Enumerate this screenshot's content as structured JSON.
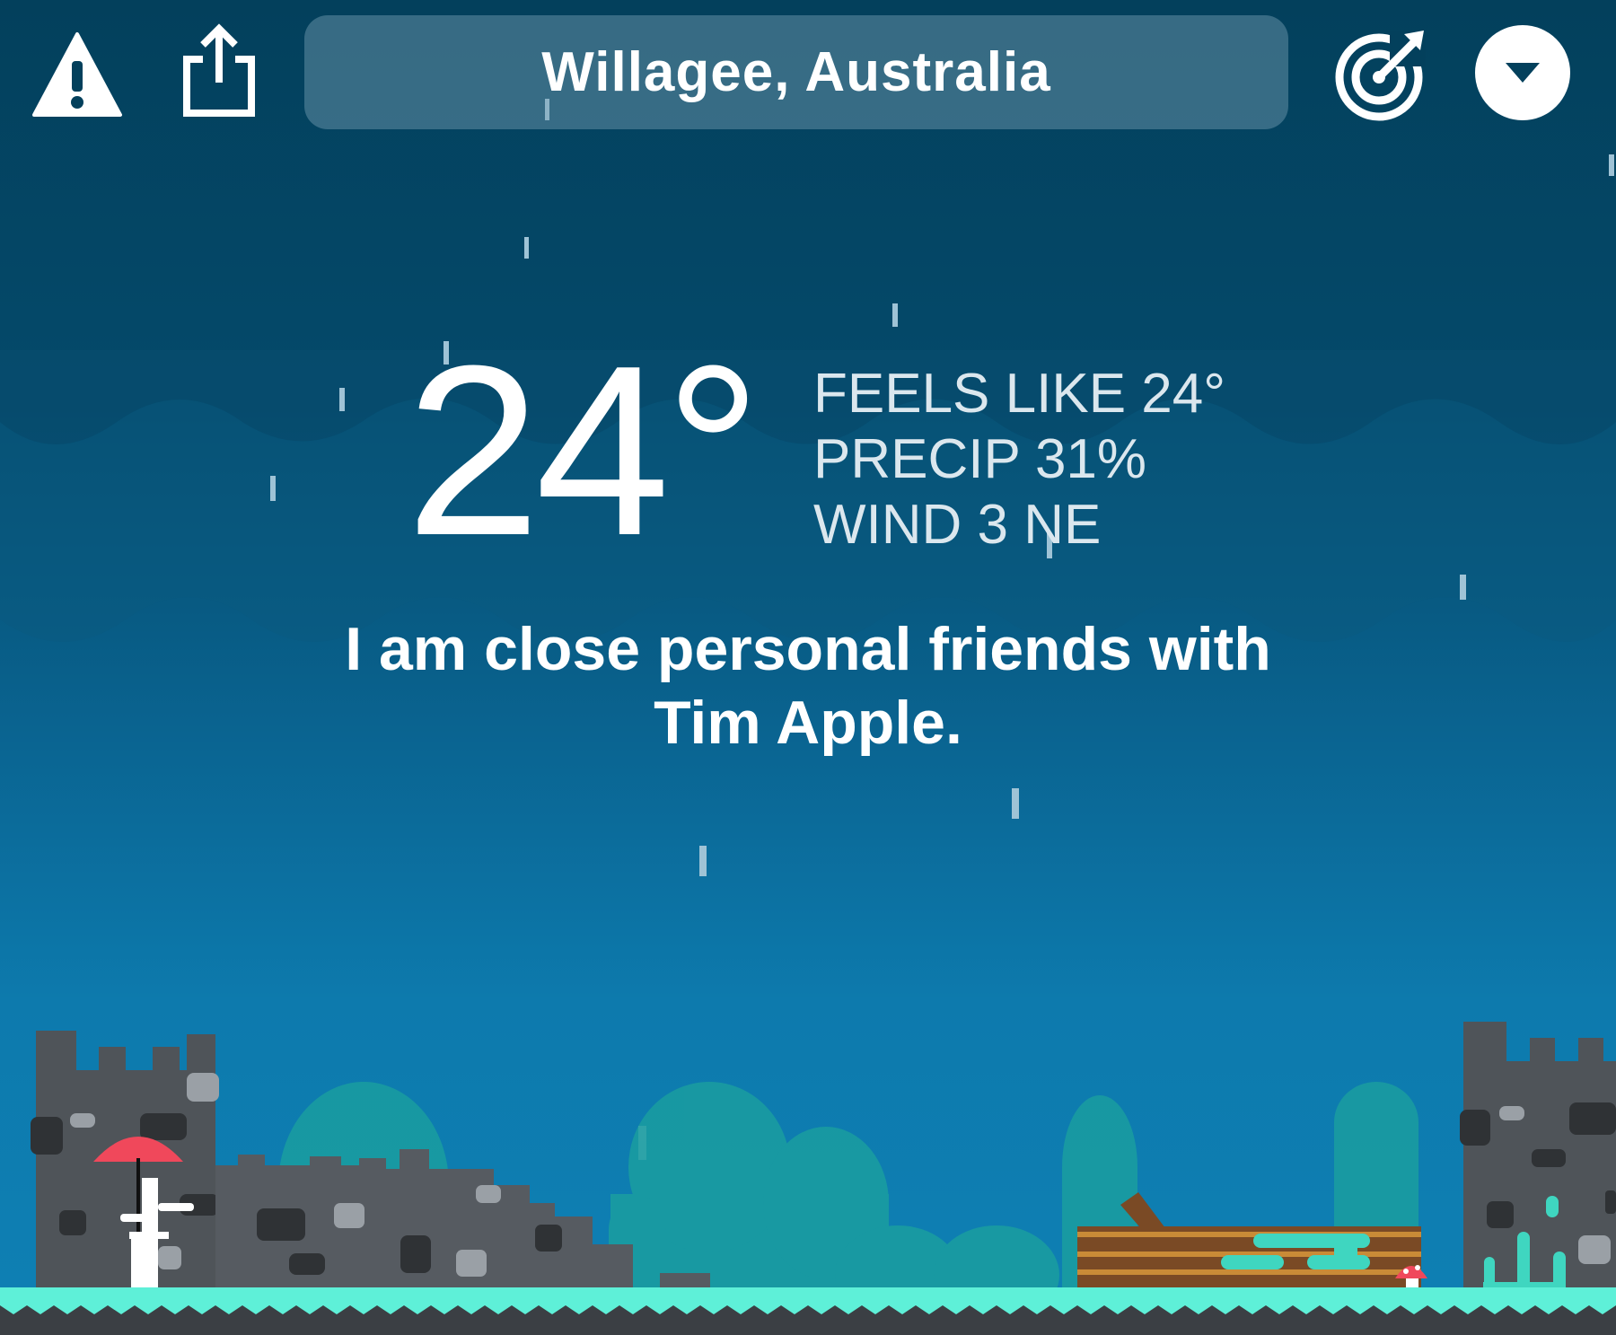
{
  "header": {
    "location": "Willagee, Australia",
    "icons": {
      "alert": "warning-triangle-icon",
      "share": "share-icon",
      "radar": "radar-icon",
      "menu": "chevron-down-icon"
    }
  },
  "weather": {
    "temperature": "24°",
    "feels_like": "FEELS LIKE 24°",
    "precip": "PRECIP 31%",
    "wind": "WIND 3 NE"
  },
  "quote": {
    "line1": "I am close personal friends with",
    "line2": "Tim Apple."
  },
  "colors": {
    "sky_top": "#03405c",
    "sky_bottom": "#0e80b4",
    "cloud": "#0a5275",
    "grass": "#5ef0d8",
    "castle": "#4f5459",
    "bush": "#1a9ea0",
    "umbrella": "#f0485b",
    "log": "#7a4a25"
  }
}
